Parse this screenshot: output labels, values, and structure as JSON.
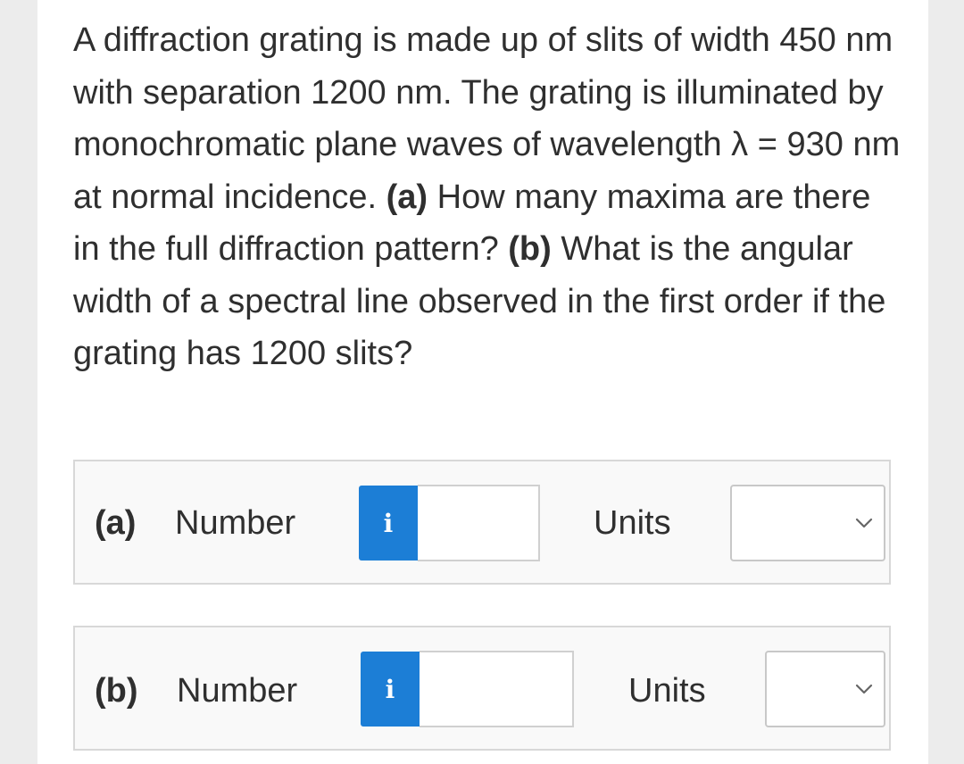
{
  "question": {
    "text_1": "A diffraction grating is made up of slits of width 450 nm with separation 1200 nm. The grating is illuminated by monochromatic plane waves of wavelength λ = 930 nm at normal incidence. ",
    "part_a_tag": "(a)",
    "text_2": " How many maxima are there in the full diffraction pattern? ",
    "part_b_tag": "(b)",
    "text_3": " What is the angular width of a spectral line observed in the first order if the grating has 1200 slits?"
  },
  "answers": [
    {
      "part_label": "(a)",
      "number_label": "Number",
      "info_icon_glyph": "i",
      "input_value": "",
      "units_label": "Units",
      "units_selected": ""
    },
    {
      "part_label": "(b)",
      "number_label": "Number",
      "info_icon_glyph": "i",
      "input_value": "",
      "units_label": "Units",
      "units_selected": ""
    }
  ],
  "colors": {
    "info_button": "#1c7ed6",
    "text": "#2f2f2f",
    "row_border": "#d8d8d8"
  },
  "icons": [
    "info-icon",
    "chevron-down-icon"
  ]
}
